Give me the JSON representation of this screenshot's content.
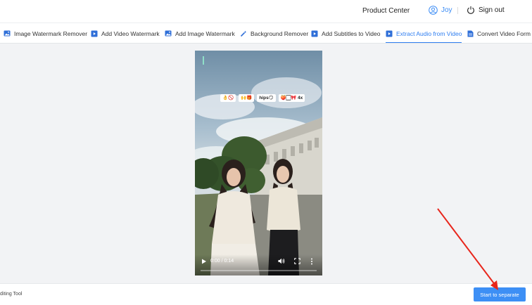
{
  "header": {
    "product_center": "Product Center",
    "user_name": "Joy",
    "sign_out": "Sign out"
  },
  "tabs": [
    {
      "label": "Image Watermark Remover",
      "icon": "image-icon"
    },
    {
      "label": "Add Video Watermark",
      "icon": "video-icon"
    },
    {
      "label": "Add Image Watermark",
      "icon": "image-icon"
    },
    {
      "label": "Background Remover",
      "icon": "magic-wand-icon"
    },
    {
      "label": "Add Subtitles to Video",
      "icon": "video-icon"
    },
    {
      "label": "Extract Audio from Video",
      "icon": "video-icon",
      "active": true
    },
    {
      "label": "Convert Video Form",
      "icon": "document-icon"
    }
  ],
  "player": {
    "stickers": [
      "👌🚫",
      "🙌🎁",
      "hips😏",
      "🍑🏻🎀 4x"
    ],
    "time": "0:00 / 0:14",
    "progress": 0.0
  },
  "footer": {
    "tool_label": "diting Tool",
    "start_button": "Start to separate"
  },
  "colors": {
    "accent": "#2f7ef0",
    "button": "#3d8ff5",
    "annotation_arrow": "#e8261c"
  }
}
